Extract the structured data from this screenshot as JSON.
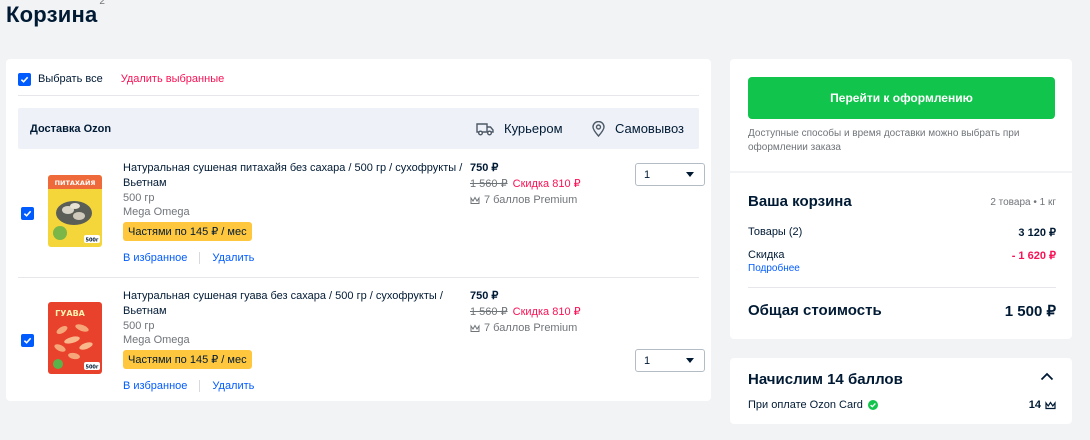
{
  "page": {
    "title": "Корзина",
    "count": "2"
  },
  "selection": {
    "select_all": "Выбрать все",
    "delete_selected": "Удалить выбранные"
  },
  "delivery": {
    "title": "Доставка Ozon",
    "courier": "Курьером",
    "pickup": "Самовывоз"
  },
  "items": [
    {
      "name": "Натуральная сушеная питахайя без сахара / 500 гр / сухофрукты / Вьетнам",
      "weight": "500 гр",
      "brand": "Mega Omega",
      "installment": "Частями по 145 ₽ / мес",
      "favorite": "В избранное",
      "delete": "Удалить",
      "price": "750 ₽",
      "old_price": "1 560 ₽",
      "discount": "Скидка 810 ₽",
      "premium": "7 баллов Premium",
      "quantity": "1",
      "thumb_label": "ПИТАХАЙЯ",
      "thumb_weight": "500г",
      "thumb_color": "#f5d63a"
    },
    {
      "name": "Натуральная сушеная гуава без сахара / 500 гр / сухофрукты / Вьетнам",
      "weight": "500 гр",
      "brand": "Mega Omega",
      "installment": "Частями по 145 ₽ / мес",
      "favorite": "В избранное",
      "delete": "Удалить",
      "price": "750 ₽",
      "old_price": "1 560 ₽",
      "discount": "Скидка 810 ₽",
      "premium": "7 баллов Premium",
      "quantity": "1",
      "thumb_label": "ГУАВА",
      "thumb_weight": "500г",
      "thumb_color": "#e8412c"
    }
  ],
  "checkout": {
    "button": "Перейти к оформлению",
    "note": "Доступные способы и время доставки можно выбрать при оформлении заказа"
  },
  "cart": {
    "title": "Ваша корзина",
    "count": "2 товара • 1 кг",
    "goods_label": "Товары (2)",
    "goods_value": "3 120 ₽",
    "discount_label": "Скидка",
    "discount_value": "- 1 620 ₽",
    "more": "Подробнее",
    "total_label": "Общая стоимость",
    "total_value": "1 500 ₽"
  },
  "points": {
    "title": "Начислим 14 баллов",
    "card_label": "При оплате Ozon Card",
    "value": "14"
  },
  "colors": {
    "accent": "#005bff",
    "green": "#10c44c",
    "red": "#f91155",
    "yellow": "#ffc73d"
  }
}
